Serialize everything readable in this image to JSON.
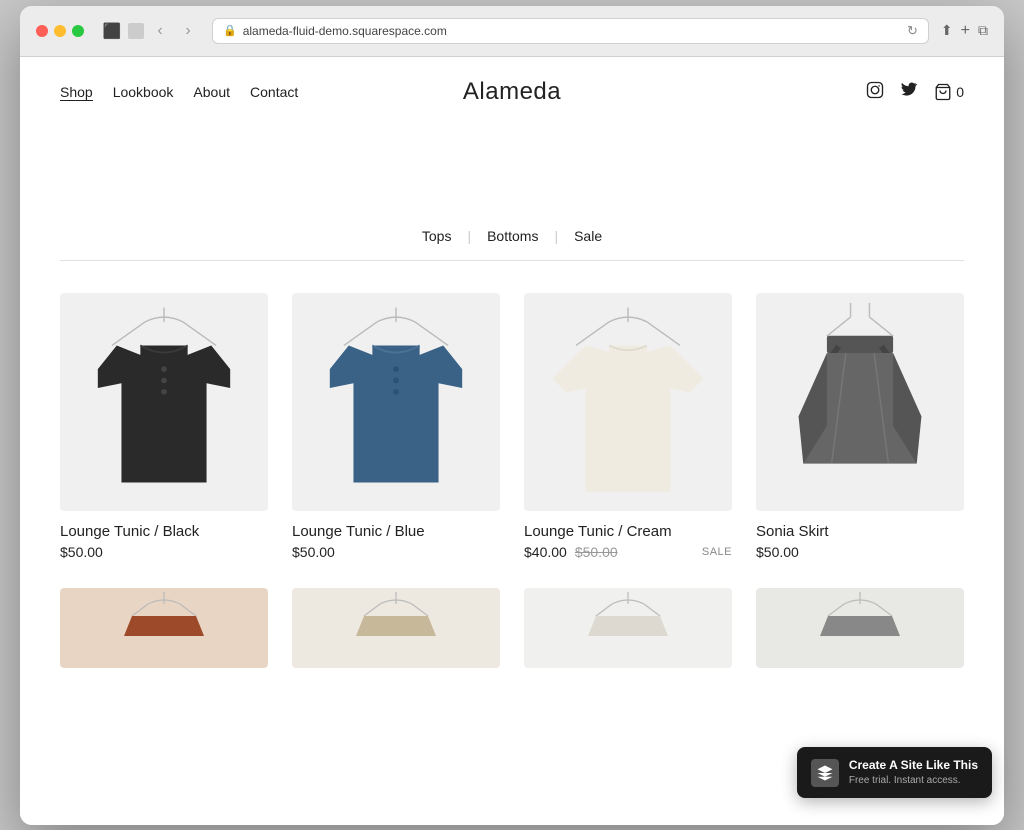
{
  "browser": {
    "url": "alameda-fluid-demo.squarespace.com",
    "back_label": "‹",
    "forward_label": "›"
  },
  "nav": {
    "links": [
      {
        "label": "Shop",
        "active": true
      },
      {
        "label": "Lookbook",
        "active": false
      },
      {
        "label": "About",
        "active": false
      },
      {
        "label": "Contact",
        "active": false
      }
    ],
    "site_title": "Alameda",
    "cart_label": "0"
  },
  "filters": {
    "tabs": [
      "Tops",
      "Bottoms",
      "Sale"
    ]
  },
  "products": [
    {
      "name": "Lounge Tunic / Black",
      "price": "$50.00",
      "original_price": null,
      "sale": false,
      "color": "black"
    },
    {
      "name": "Lounge Tunic / Blue",
      "price": "$50.00",
      "original_price": null,
      "sale": false,
      "color": "blue"
    },
    {
      "name": "Lounge Tunic / Cream",
      "price": "$40.00",
      "original_price": "$50.00",
      "sale": true,
      "color": "cream"
    },
    {
      "name": "Sonia Skirt",
      "price": "$50.00",
      "original_price": null,
      "sale": false,
      "color": "gray"
    }
  ],
  "partial_products": [
    {
      "color": "rust"
    },
    {
      "color": "tan"
    },
    {
      "color": "light"
    },
    {
      "color": "dark"
    }
  ],
  "badge": {
    "title": "Create A Site Like This",
    "subtitle": "Free trial. Instant access."
  }
}
